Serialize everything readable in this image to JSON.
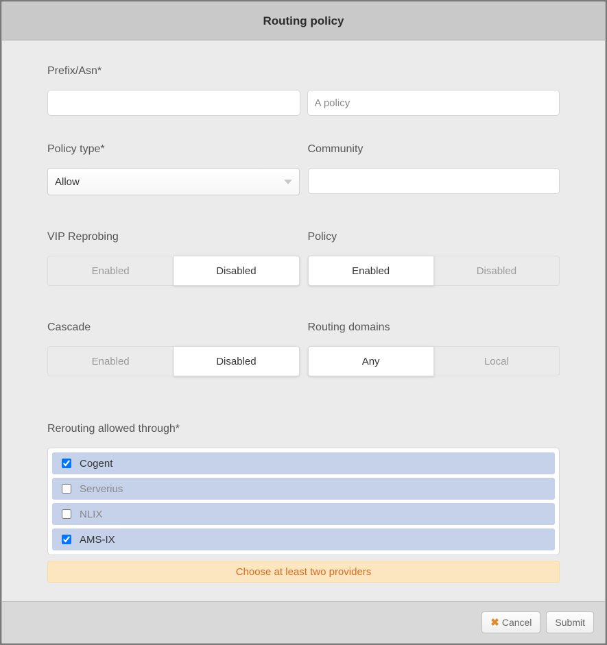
{
  "dialog": {
    "title": "Routing policy"
  },
  "labels": {
    "prefix_asn": "Prefix/Asn*",
    "policy_type": "Policy type*",
    "community": "Community",
    "vip_reprobing": "VIP Reprobing",
    "policy": "Policy",
    "cascade": "Cascade",
    "routing_domains": "Routing domains",
    "rerouting": "Rerouting allowed through*"
  },
  "placeholders": {
    "description": "A policy"
  },
  "policy_type": {
    "value": "Allow"
  },
  "community": {
    "value": ""
  },
  "prefix_asn": {
    "value": ""
  },
  "toggles": {
    "vip_reprobing": {
      "options": [
        "Enabled",
        "Disabled"
      ],
      "active": "Disabled"
    },
    "policy": {
      "options": [
        "Enabled",
        "Disabled"
      ],
      "active": "Enabled"
    },
    "cascade": {
      "options": [
        "Enabled",
        "Disabled"
      ],
      "active": "Disabled"
    },
    "routing_domains": {
      "options": [
        "Any",
        "Local"
      ],
      "active": "Any"
    }
  },
  "providers": [
    {
      "name": "Cogent",
      "checked": true
    },
    {
      "name": "Serverius",
      "checked": false
    },
    {
      "name": "NLIX",
      "checked": false
    },
    {
      "name": "AMS-IX",
      "checked": true
    }
  ],
  "warning": "Choose at least two providers",
  "footer": {
    "cancel": "Cancel",
    "submit": "Submit"
  }
}
